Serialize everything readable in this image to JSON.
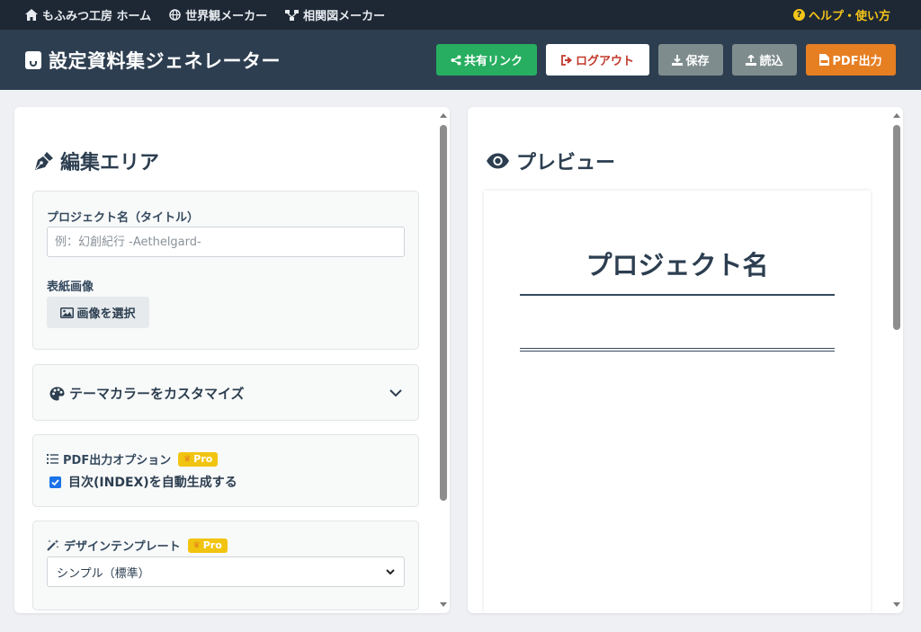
{
  "topnav": {
    "home": "もふみつ工房 ホーム",
    "worldview": "世界観メーカー",
    "diagram": "相関図メーカー",
    "help": "ヘルプ・使い方"
  },
  "header": {
    "title": "設定資料集ジェネレーター",
    "buttons": {
      "share": "共有リンク",
      "logout": "ログアウト",
      "save": "保存",
      "load": "読込",
      "pdf": "PDF出力"
    }
  },
  "editor": {
    "heading": "編集エリア",
    "project_label": "プロジェクト名（タイトル）",
    "project_placeholder": "例：幻創紀行 -Aethelgard-",
    "project_value": "",
    "cover_label": "表紙画像",
    "cover_button": "画像を選択",
    "theme_toggle": "テーマカラーをカスタマイズ",
    "pdf_options": {
      "title": "PDF出力オプション",
      "badge": "Pro",
      "toc_label": "目次(INDEX)を自動生成する",
      "toc_checked": true
    },
    "template": {
      "title": "デザインテンプレート",
      "badge": "Pro",
      "selected": "シンプル（標準）"
    }
  },
  "preview": {
    "heading": "プレビュー",
    "doc_title": "プロジェクト名"
  },
  "colors": {
    "nav_bg": "#1e2835",
    "header_bg": "#2d3e50",
    "share": "#27ae60",
    "logout_text": "#c0392b",
    "neutral_btn": "#7f8c8d",
    "pdf": "#e67e22",
    "help": "#f5c518",
    "pro_badge": "#f1c40f"
  }
}
